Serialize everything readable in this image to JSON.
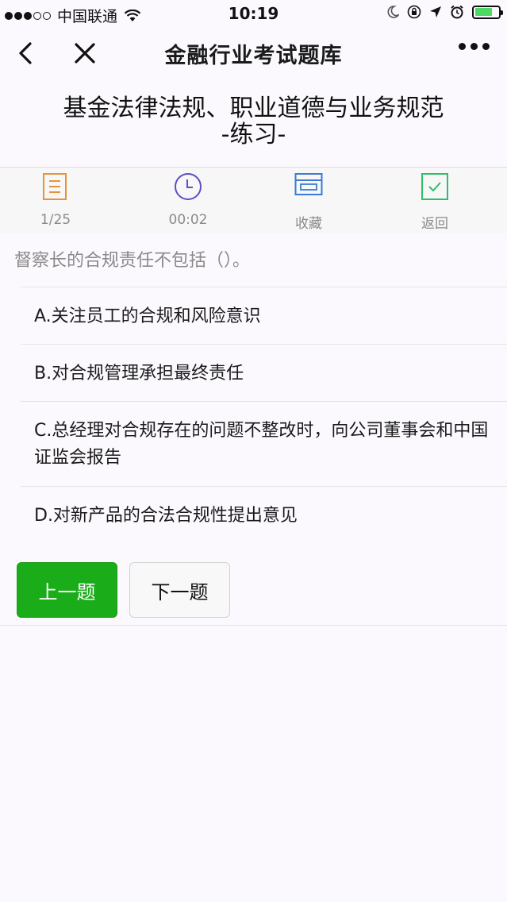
{
  "status_bar": {
    "carrier": "中国联通",
    "time": "10:19",
    "battery_percent": 0.75
  },
  "nav": {
    "title": "金融行业考试题库",
    "icons": [
      "back-arrow-icon",
      "close-icon",
      "more-icon"
    ]
  },
  "page": {
    "title_line1": "基金法律法规、职业道德与业务规范",
    "title_line2": "-练习-"
  },
  "toolbar": {
    "progress": "1/25",
    "timer": "00:02",
    "favorite": "收藏",
    "back": "返回"
  },
  "question": {
    "text": "督察长的合规责任不包括（）。",
    "options": [
      "A.关注员工的合规和风险意识",
      "B.对合规管理承担最终责任",
      "C.总经理对合规存在的问题不整改时，向公司董事会和中国证监会报告",
      "D.对新产品的合法合规性提出意见"
    ]
  },
  "buttons": {
    "prev": "上一题",
    "next": "下一题"
  },
  "colors": {
    "accent_green": "#1aad19",
    "icon_orange": "#e8923a",
    "icon_purple": "#5b4fc4",
    "icon_blue": "#3b7bd4",
    "icon_green": "#2fbf6a"
  }
}
